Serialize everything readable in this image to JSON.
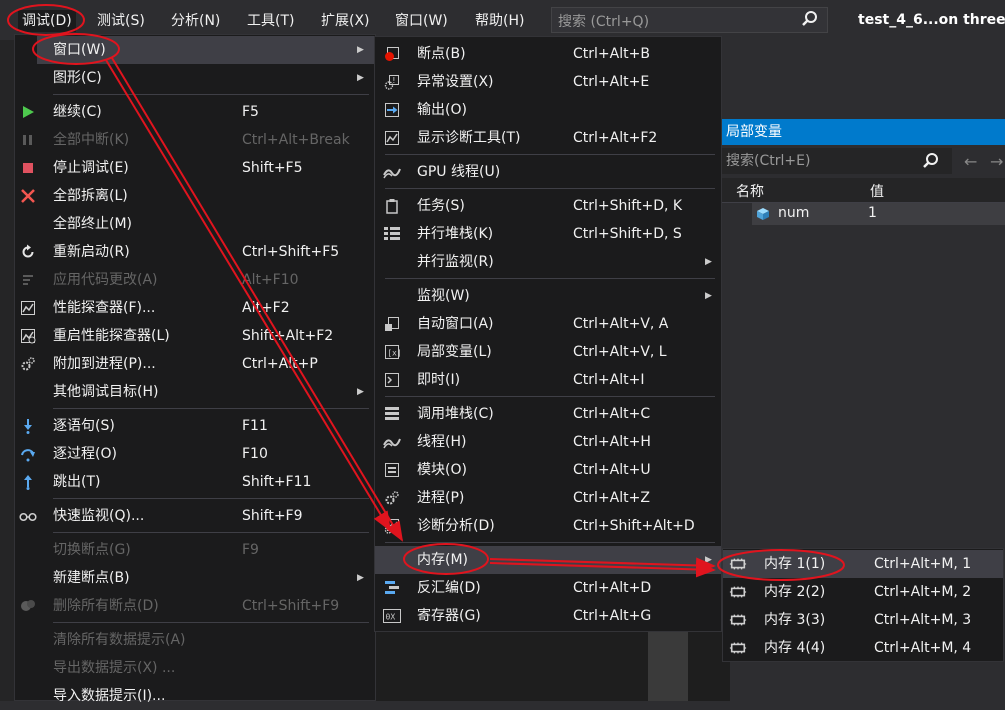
{
  "menubar": {
    "items": [
      "调试(D)",
      "测试(S)",
      "分析(N)",
      "工具(T)",
      "扩展(X)",
      "窗口(W)",
      "帮助(H)"
    ],
    "search_placeholder": "搜索 (Ctrl+Q)",
    "window_title": "test_4_6...on three"
  },
  "debug_menu": {
    "items": [
      {
        "label": "窗口(W)",
        "shortcut": "",
        "icon": "none",
        "submenu": true,
        "disabled": false
      },
      {
        "label": "图形(C)",
        "shortcut": "",
        "icon": "none",
        "submenu": true,
        "disabled": false
      },
      {
        "label": "继续(C)",
        "shortcut": "F5",
        "icon": "play-icon",
        "submenu": false,
        "disabled": false
      },
      {
        "label": "全部中断(K)",
        "shortcut": "Ctrl+Alt+Break",
        "icon": "pause-icon",
        "submenu": false,
        "disabled": true
      },
      {
        "label": "停止调试(E)",
        "shortcut": "Shift+F5",
        "icon": "stop-icon",
        "submenu": false,
        "disabled": false
      },
      {
        "label": "全部拆离(L)",
        "shortcut": "",
        "icon": "detach-x-icon",
        "submenu": false,
        "disabled": false
      },
      {
        "label": "全部终止(M)",
        "shortcut": "",
        "icon": "none",
        "submenu": false,
        "disabled": false
      },
      {
        "label": "重新启动(R)",
        "shortcut": "Ctrl+Shift+F5",
        "icon": "restart-icon",
        "submenu": false,
        "disabled": false
      },
      {
        "label": "应用代码更改(A)",
        "shortcut": "Alt+F10",
        "icon": "apply-changes-icon",
        "submenu": false,
        "disabled": true
      },
      {
        "label": "性能探查器(F)...",
        "shortcut": "Alt+F2",
        "icon": "profiler-icon",
        "submenu": false,
        "disabled": false
      },
      {
        "label": "重启性能探查器(L)",
        "shortcut": "Shift+Alt+F2",
        "icon": "profiler-restart-icon",
        "submenu": false,
        "disabled": false
      },
      {
        "label": "附加到进程(P)...",
        "shortcut": "Ctrl+Alt+P",
        "icon": "gears-icon",
        "submenu": false,
        "disabled": false
      },
      {
        "label": "其他调试目标(H)",
        "shortcut": "",
        "icon": "none",
        "submenu": true,
        "disabled": false
      },
      {
        "label": "逐语句(S)",
        "shortcut": "F11",
        "icon": "step-into-icon",
        "submenu": false,
        "disabled": false
      },
      {
        "label": "逐过程(O)",
        "shortcut": "F10",
        "icon": "step-over-icon",
        "submenu": false,
        "disabled": false
      },
      {
        "label": "跳出(T)",
        "shortcut": "Shift+F11",
        "icon": "step-out-icon",
        "submenu": false,
        "disabled": false
      },
      {
        "label": "快速监视(Q)...",
        "shortcut": "Shift+F9",
        "icon": "glasses-icon",
        "submenu": false,
        "disabled": false
      },
      {
        "label": "切换断点(G)",
        "shortcut": "F9",
        "icon": "none",
        "submenu": false,
        "disabled": true
      },
      {
        "label": "新建断点(B)",
        "shortcut": "",
        "icon": "none",
        "submenu": true,
        "disabled": false
      },
      {
        "label": "删除所有断点(D)",
        "shortcut": "Ctrl+Shift+F9",
        "icon": "delete-breakpoints-icon",
        "submenu": false,
        "disabled": true
      },
      {
        "label": "清除所有数据提示(A)",
        "shortcut": "",
        "icon": "none",
        "submenu": false,
        "disabled": true
      },
      {
        "label": "导出数据提示(X) ...",
        "shortcut": "",
        "icon": "none",
        "submenu": false,
        "disabled": true
      },
      {
        "label": "导入数据提示(I)...",
        "shortcut": "",
        "icon": "none",
        "submenu": false,
        "disabled": false
      }
    ]
  },
  "window_submenu": {
    "items": [
      {
        "label": "断点(B)",
        "shortcut": "Ctrl+Alt+B",
        "icon": "breakpoint-icon",
        "submenu": false
      },
      {
        "label": "异常设置(X)",
        "shortcut": "Ctrl+Alt+E",
        "icon": "exception-settings-icon",
        "submenu": false
      },
      {
        "label": "输出(O)",
        "shortcut": "",
        "icon": "output-icon",
        "submenu": false
      },
      {
        "label": "显示诊断工具(T)",
        "shortcut": "Ctrl+Alt+F2",
        "icon": "diagnostic-tools-icon",
        "submenu": false
      },
      {
        "label": "GPU 线程(U)",
        "shortcut": "",
        "icon": "gpu-threads-icon",
        "submenu": false
      },
      {
        "label": "任务(S)",
        "shortcut": "Ctrl+Shift+D, K",
        "icon": "tasks-icon",
        "submenu": false
      },
      {
        "label": "并行堆栈(K)",
        "shortcut": "Ctrl+Shift+D, S",
        "icon": "parallel-stacks-icon",
        "submenu": false
      },
      {
        "label": "并行监视(R)",
        "shortcut": "",
        "icon": "none",
        "submenu": true
      },
      {
        "label": "监视(W)",
        "shortcut": "",
        "icon": "none",
        "submenu": true
      },
      {
        "label": "自动窗口(A)",
        "shortcut": "Ctrl+Alt+V, A",
        "icon": "autos-icon",
        "submenu": false
      },
      {
        "label": "局部变量(L)",
        "shortcut": "Ctrl+Alt+V, L",
        "icon": "locals-icon",
        "submenu": false
      },
      {
        "label": "即时(I)",
        "shortcut": "Ctrl+Alt+I",
        "icon": "immediate-icon",
        "submenu": false
      },
      {
        "label": "调用堆栈(C)",
        "shortcut": "Ctrl+Alt+C",
        "icon": "call-stack-icon",
        "submenu": false
      },
      {
        "label": "线程(H)",
        "shortcut": "Ctrl+Alt+H",
        "icon": "threads-icon",
        "submenu": false
      },
      {
        "label": "模块(O)",
        "shortcut": "Ctrl+Alt+U",
        "icon": "modules-icon",
        "submenu": false
      },
      {
        "label": "进程(P)",
        "shortcut": "Ctrl+Alt+Z",
        "icon": "processes-icon",
        "submenu": false
      },
      {
        "label": "诊断分析(D)",
        "shortcut": "Ctrl+Shift+Alt+D",
        "icon": "diagnostic-analysis-icon",
        "submenu": false
      },
      {
        "label": "内存(M)",
        "shortcut": "",
        "icon": "none",
        "submenu": true
      },
      {
        "label": "反汇编(D)",
        "shortcut": "Ctrl+Alt+D",
        "icon": "disassembly-icon",
        "submenu": false
      },
      {
        "label": "寄存器(G)",
        "shortcut": "Ctrl+Alt+G",
        "icon": "registers-icon",
        "submenu": false
      }
    ]
  },
  "memory_submenu": {
    "items": [
      {
        "label": "内存 1(1)",
        "shortcut": "Ctrl+Alt+M, 1",
        "icon": "memory-chip-icon"
      },
      {
        "label": "内存 2(2)",
        "shortcut": "Ctrl+Alt+M, 2",
        "icon": "memory-chip-icon"
      },
      {
        "label": "内存 3(3)",
        "shortcut": "Ctrl+Alt+M, 3",
        "icon": "memory-chip-icon"
      },
      {
        "label": "内存 4(4)",
        "shortcut": "Ctrl+Alt+M, 4",
        "icon": "memory-chip-icon"
      }
    ]
  },
  "locals_panel": {
    "title": "局部变量",
    "search_placeholder": "搜索(Ctrl+E)",
    "columns": [
      "名称",
      "值"
    ],
    "rows": [
      {
        "name": "num",
        "value": "1"
      }
    ]
  },
  "colors": {
    "menu_bg": "#1b1b1c",
    "highlight": "#3f3f46",
    "accent": "#007acc",
    "annotation_red": "#e0141e",
    "disabled_text": "#656565"
  }
}
